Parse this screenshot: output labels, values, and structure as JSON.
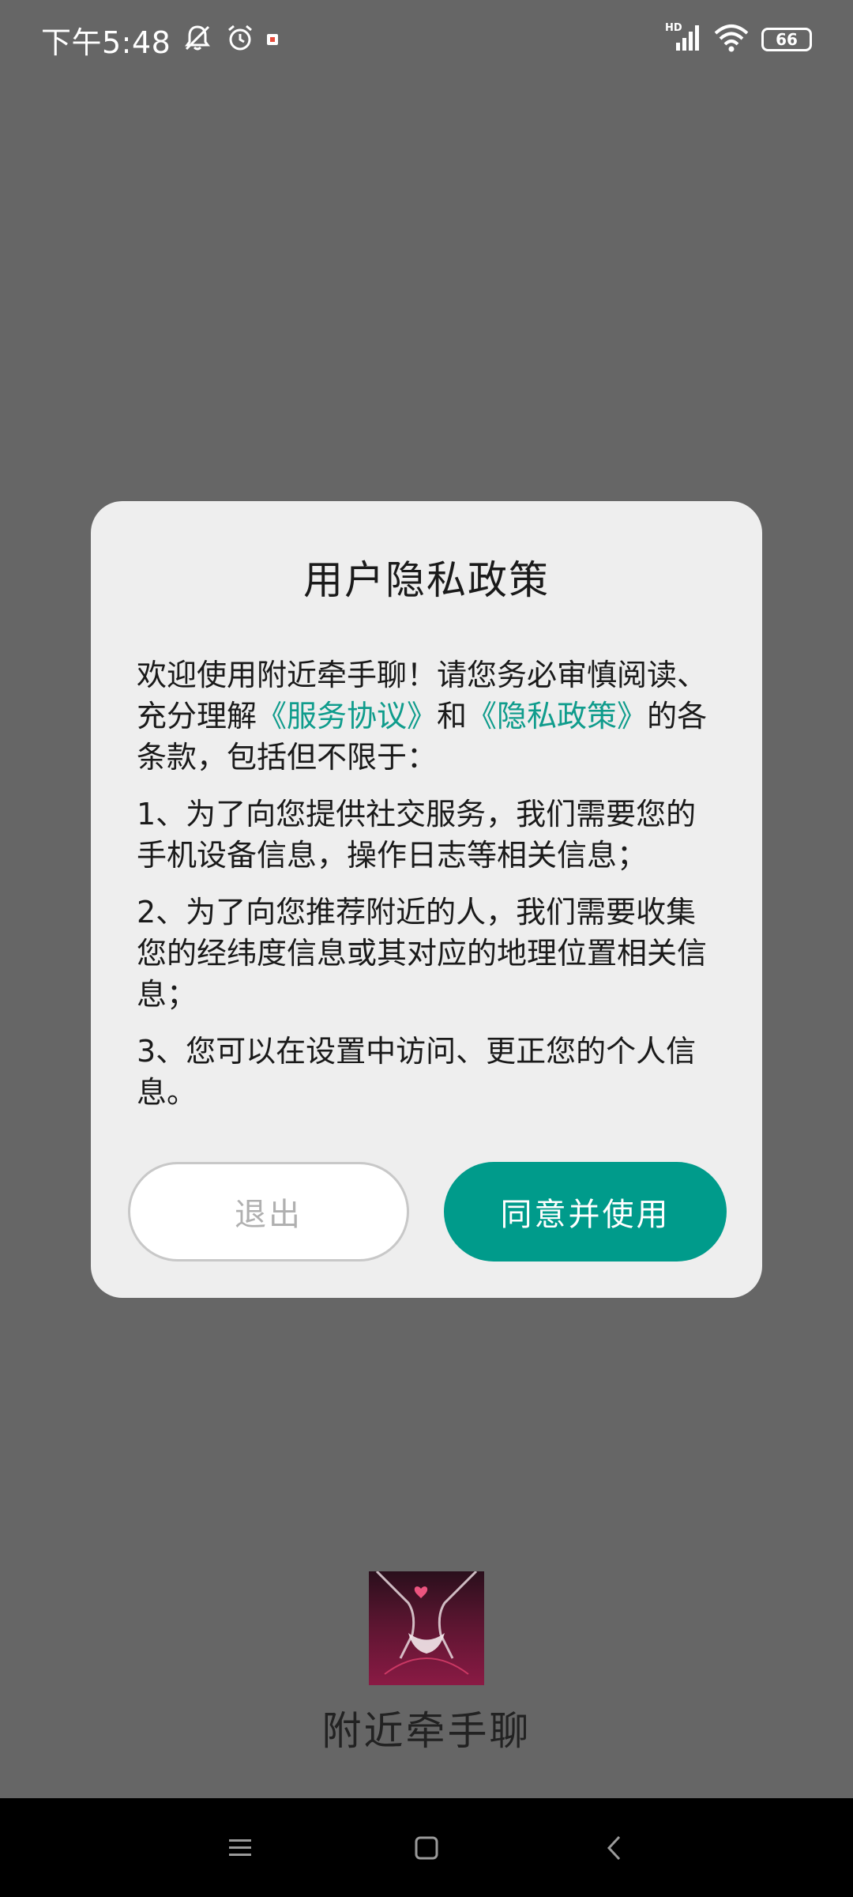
{
  "status_bar": {
    "time": "下午5:48",
    "network_label": "HD",
    "battery": "66"
  },
  "dialog": {
    "title": "用户隐私政策",
    "intro": {
      "prefix": "欢迎使用附近牵手聊！请您务必审慎阅读、充分理解",
      "link_service": "《服务协议》",
      "and": "和",
      "link_privacy": "《隐私政策》",
      "suffix": "的各条款，包括但不限于："
    },
    "items": [
      "1、为了向您提供社交服务，我们需要您的手机设备信息，操作日志等相关信息；",
      "2、为了向您推荐附近的人，我们需要收集您的经纬度信息或其对应的地理位置相关信息；",
      "3、您可以在设置中访问、更正您的个人信息。"
    ],
    "buttons": {
      "exit": "退出",
      "agree": "同意并使用"
    }
  },
  "app": {
    "name": "附近牵手聊",
    "logo_icon": "holding-hands-logo"
  },
  "colors": {
    "accent": "#009b8b",
    "link": "#0f9c8c",
    "background_scrim": "#666666",
    "dialog_bg": "#eeeeee"
  },
  "nav_bar": {
    "icons": [
      "menu-icon",
      "home-icon",
      "back-icon"
    ]
  }
}
